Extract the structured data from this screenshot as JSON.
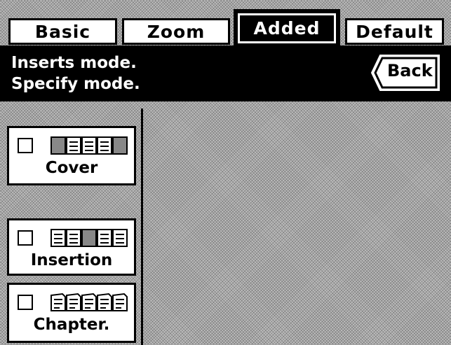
{
  "tabs": [
    {
      "label": "Basic",
      "active": false
    },
    {
      "label": "Zoom",
      "active": false
    },
    {
      "label": "Added",
      "active": true
    },
    {
      "label": "Default",
      "active": false
    }
  ],
  "message": {
    "line1": "Inserts mode.",
    "line2": "Specify mode."
  },
  "back_button": {
    "label": "Back"
  },
  "modes": [
    {
      "label": "Cover",
      "icon": "cover-pages-icon"
    },
    {
      "label": "Insertion",
      "icon": "insertion-pages-icon"
    },
    {
      "label": "Chapter.",
      "icon": "chapter-pages-icon"
    }
  ]
}
